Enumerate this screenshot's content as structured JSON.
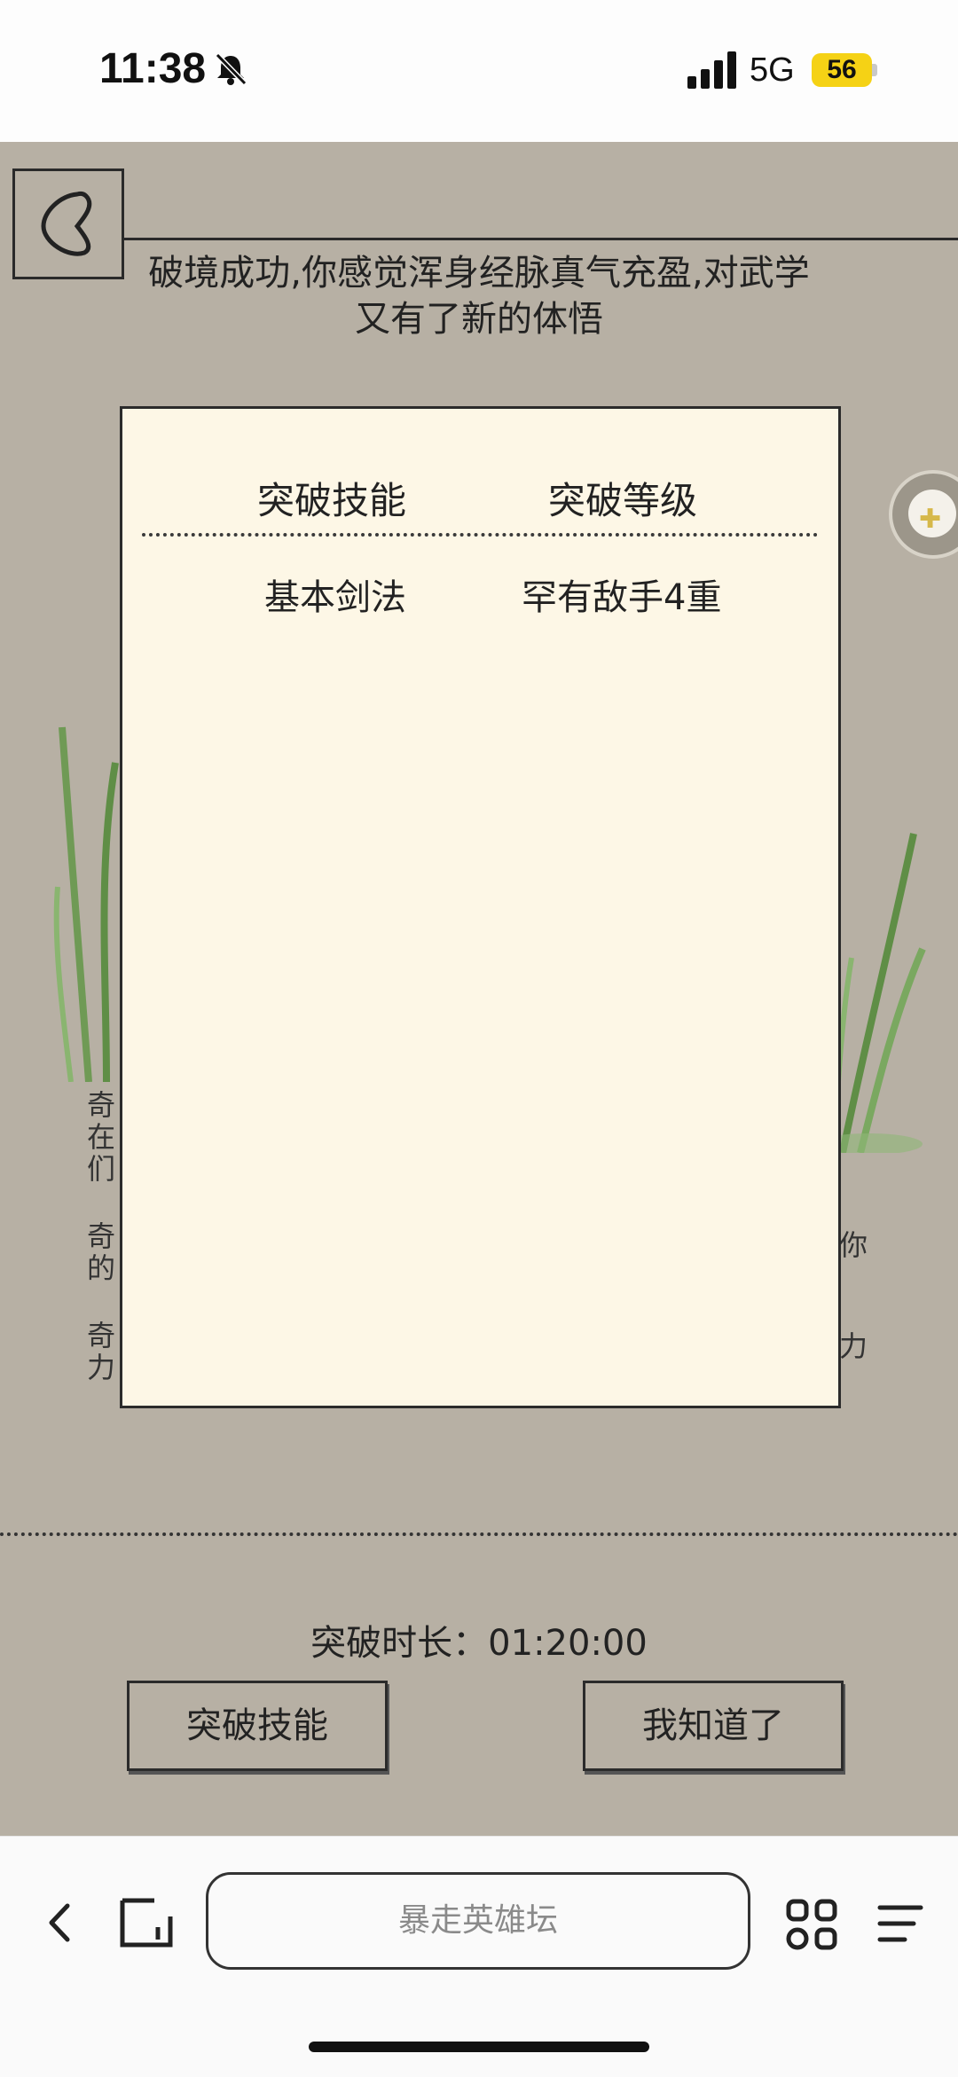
{
  "status_bar": {
    "time": "11:38",
    "network": "5G",
    "battery": "56"
  },
  "game": {
    "message": "破境成功,你感觉浑身经脉真气充盈,对武学又有了新的体悟",
    "side_text_left": [
      "奇",
      "在",
      "们",
      "奇",
      "的",
      "奇",
      "力"
    ],
    "side_text_right": [
      "",
      "",
      "你",
      "",
      "",
      "",
      "力"
    ],
    "modal": {
      "headers": [
        "突破技能",
        "突破等级"
      ],
      "rows": [
        {
          "skill": "基本剑法",
          "level": "罕有敌手4重"
        }
      ]
    },
    "duration_label": "突破时长：",
    "duration_value": "01:20:00",
    "buttons": {
      "skill": "突破技能",
      "ok": "我知道了"
    }
  },
  "browser": {
    "address": "暴走英雄坛"
  },
  "colors": {
    "background": "#b7b0a4",
    "modal": "#fdf7e6"
  }
}
